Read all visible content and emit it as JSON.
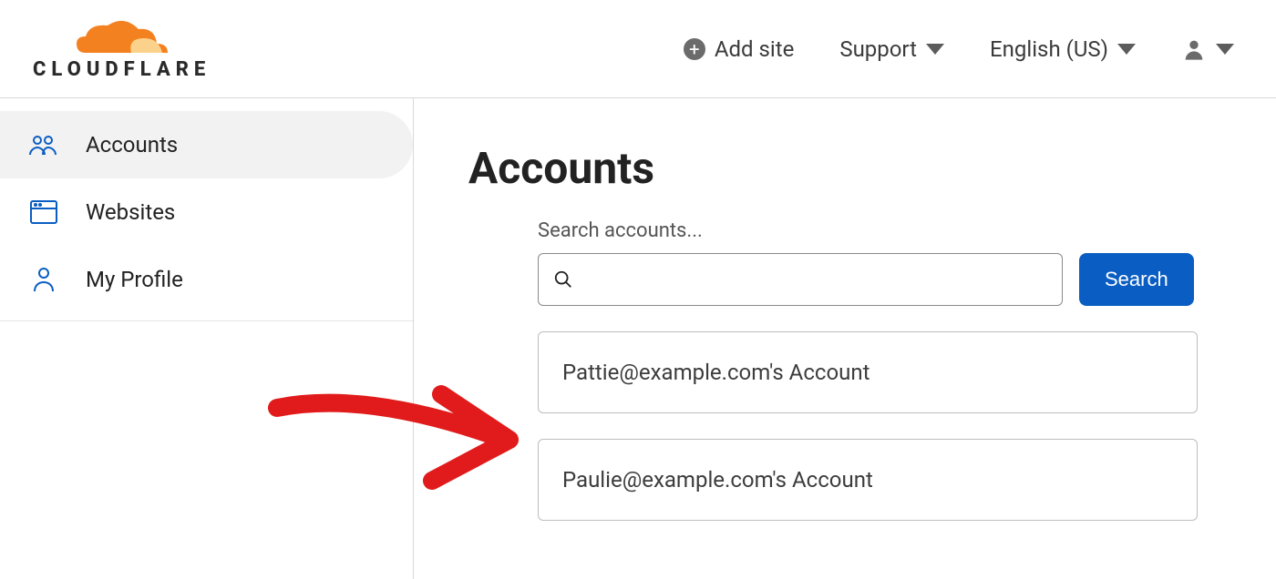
{
  "header": {
    "brand_word": "CLOUDFLARE",
    "add_site_label": "Add site",
    "support_label": "Support",
    "language_label": "English (US)"
  },
  "sidebar": {
    "items": [
      {
        "label": "Accounts",
        "icon": "people-icon",
        "active": true
      },
      {
        "label": "Websites",
        "icon": "browser-icon",
        "active": false
      },
      {
        "label": "My Profile",
        "icon": "person-icon",
        "active": false
      }
    ]
  },
  "main": {
    "title": "Accounts",
    "search_label": "Search accounts...",
    "search_button": "Search",
    "accounts": [
      "Pattie@example.com's Account",
      "Paulie@example.com's Account"
    ]
  }
}
